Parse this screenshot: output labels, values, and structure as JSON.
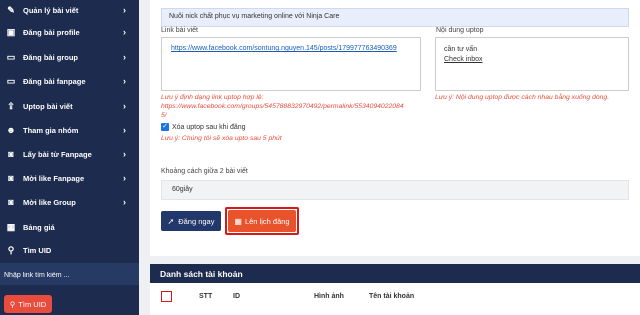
{
  "sidebar": {
    "items": [
      {
        "label": "Quản lý bài viết",
        "icon": "pencil-icon",
        "glyph": "✎",
        "chevron": true
      },
      {
        "label": "Đăng bài profile",
        "icon": "image-icon",
        "glyph": "▣",
        "chevron": true
      },
      {
        "label": "Đăng bài group",
        "icon": "monitor-icon",
        "glyph": "▭",
        "chevron": true
      },
      {
        "label": "Đăng bài fanpage",
        "icon": "monitor-icon",
        "glyph": "▭",
        "chevron": true
      },
      {
        "label": "Uptop bài viết",
        "icon": "upload-icon",
        "glyph": "⇪",
        "chevron": true
      },
      {
        "label": "Tham gia nhóm",
        "icon": "users-icon",
        "glyph": "☻",
        "chevron": true
      },
      {
        "label": "Lấy bài từ Fanpage",
        "icon": "thumbs-up-icon",
        "glyph": "◙",
        "chevron": true
      },
      {
        "label": "Mời like Fanpage",
        "icon": "thumbs-up-icon",
        "glyph": "◙",
        "chevron": true
      },
      {
        "label": "Mời like Group",
        "icon": "thumbs-up-icon",
        "glyph": "◙",
        "chevron": true
      },
      {
        "label": "Bảng giá",
        "icon": "table-icon",
        "glyph": "▦",
        "chevron": false
      },
      {
        "label": "Tìm UID",
        "icon": "search-icon",
        "glyph": "⚲",
        "chevron": false
      }
    ],
    "search_placeholder": "Nhập link tìm kiếm ...",
    "find_uid_button": "Tìm UID"
  },
  "form": {
    "banner": "Nuôi nick chất phục vụ marketing online với Ninja Care",
    "post_link_label": "Link bài viết",
    "post_link_value": "https://www.facebook.com/sontung.nguyen.145/posts/179977763490369",
    "post_link_note_line1": "Lưu ý định dạng link uptop hợp lệ:",
    "post_link_note_line2": "https://www.facebook.com/groups/545788832970492/permalink/5534094022084",
    "post_link_note_line3": "5/",
    "content_label": "Nội dung uptop",
    "content_lines": [
      "cần tư vấn",
      "Check inbox"
    ],
    "content_note": "Lưu ý: Nội dung uptop được cách nhau bằng xuống dòng.",
    "delete_checkbox_label": "Xóa uptop sau khi đăng",
    "delete_checked": true,
    "delete_note": "Lưu ý: Chúng tôi sẽ xóa upto sau 5 phút",
    "interval_label": "Khoảng cách giữa 2 bài viết",
    "interval_value": "60giây",
    "post_now_button": "Đăng ngay",
    "schedule_button": "Lên lịch đăng"
  },
  "accounts": {
    "title": "Danh sách tài khoản",
    "columns": [
      "STT",
      "ID",
      "Hình ảnh",
      "Tên tài khoản"
    ]
  },
  "colors": {
    "sidebar": "#1d2b4f",
    "primary": "#1d2b4f",
    "accent": "#e8532c",
    "highlight": "#d7191c",
    "note": "#e74c3c"
  }
}
